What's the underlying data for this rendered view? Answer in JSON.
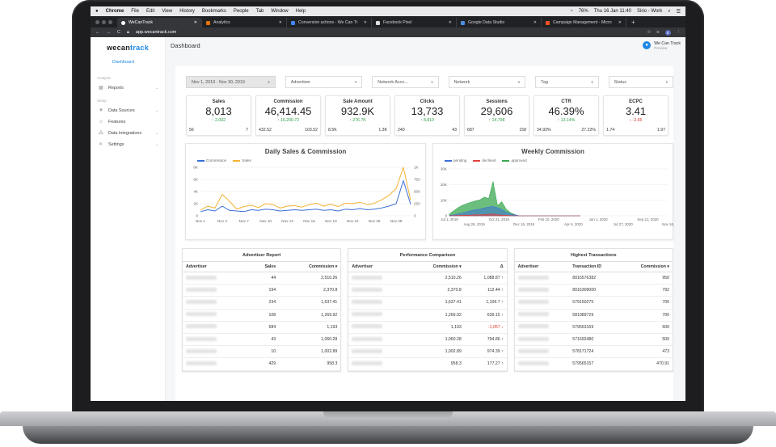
{
  "menubar": {
    "apple": "",
    "items": [
      "Chrome",
      "File",
      "Edit",
      "View",
      "History",
      "Bookmarks",
      "People",
      "Tab",
      "Window",
      "Help"
    ],
    "battery": "76%",
    "clock": "Thu 16 Jan 11:40",
    "user": "Sirio - Work"
  },
  "browser": {
    "tabs": [
      {
        "title": "WeCanTrack",
        "active": true
      },
      {
        "title": "Analytics",
        "active": false
      },
      {
        "title": "Conversion actions - We Can Tr",
        "active": false
      },
      {
        "title": "Facebook Pixel",
        "active": false
      },
      {
        "title": "Google Data Studio",
        "active": false
      },
      {
        "title": "Campaign Management - Micro",
        "active": false
      }
    ],
    "url": "app.wecantrack.com",
    "avatar": "S"
  },
  "sidebar": {
    "logo_a": "wecan",
    "logo_b": "track",
    "dashboard": "Dashboard",
    "section_analysis": "Analysis",
    "section_setup": "Setup",
    "items": [
      {
        "label": "Reports",
        "icon": "chart-icon"
      },
      {
        "label": "Data Sources",
        "icon": "funnel-icon"
      },
      {
        "label": "Features",
        "icon": "people-icon"
      },
      {
        "label": "Data Integrations",
        "icon": "nodes-icon"
      },
      {
        "label": "Settings",
        "icon": "wrench-icon"
      }
    ]
  },
  "header": {
    "title": "Dashboard",
    "user_name": "We Can Track",
    "user_sub": "Preview"
  },
  "filters": {
    "date": "Nov 1, 2019 - Nov 30, 2019",
    "advertiser": "Advertiser",
    "network": "Network Acco...",
    "network2": "Network",
    "tag": "Tag",
    "status": "Status"
  },
  "kpis": [
    {
      "title": "Sales",
      "value": "8,013",
      "delta": "↑ 2,092",
      "dir": "up",
      "left": "56",
      "right": "7"
    },
    {
      "title": "Commission",
      "value": "46,414.45",
      "delta": "↑ 16,200.72",
      "dir": "up",
      "left": "432.52",
      "right": "103.52"
    },
    {
      "title": "Sale Amount",
      "value": "932.9K",
      "delta": "↑ 276.7K",
      "dir": "up",
      "left": "8.5K",
      "right": "1.3K"
    },
    {
      "title": "Clicks",
      "value": "13,733",
      "delta": "↑ 8,810",
      "dir": "up",
      "left": "240",
      "right": "43"
    },
    {
      "title": "Sessions",
      "value": "29,606",
      "delta": "↑ 14,798",
      "dir": "up",
      "left": "687",
      "right": "158"
    },
    {
      "title": "CTR",
      "value": "46.39%",
      "delta": "↑ 13.14%",
      "dir": "up",
      "left": "34.93%",
      "right": "27.22%"
    },
    {
      "title": "ECPC",
      "value": "3.41",
      "delta": "↓ -2.65",
      "dir": "dn",
      "left": "1.74",
      "right": "1.97"
    }
  ],
  "chart_data": [
    {
      "type": "line",
      "title": "Daily Sales & Commission",
      "x": [
        "Nov 1",
        "Nov 4",
        "Nov 7",
        "Nov 10",
        "Nov 13",
        "Nov 16",
        "Nov 19",
        "Nov 22",
        "Nov 25",
        "Nov 28"
      ],
      "yticks_left": [
        "0",
        "2K",
        "4K",
        "6K",
        "8K"
      ],
      "yticks_right": [
        "0",
        "250",
        "500",
        "750",
        "1K"
      ],
      "ylim_left": [
        0,
        8000
      ],
      "ylim_right": [
        0,
        1000
      ],
      "series": [
        {
          "name": "Commission",
          "color": "#3b6fd8",
          "axis": "left",
          "values": [
            700,
            1000,
            800,
            1600,
            900,
            800,
            700,
            1000,
            900,
            1100,
            1000,
            800,
            900,
            1000,
            900,
            1000,
            1100,
            900,
            1000,
            800,
            1100,
            1000,
            1200,
            1000,
            1100,
            1300,
            1600,
            2000,
            5800,
            1900
          ]
        },
        {
          "name": "Sales",
          "color": "#f2b233",
          "axis": "right",
          "values": [
            120,
            200,
            160,
            440,
            300,
            140,
            190,
            220,
            170,
            250,
            230,
            160,
            200,
            210,
            180,
            230,
            260,
            200,
            240,
            190,
            260,
            250,
            280,
            230,
            260,
            330,
            420,
            560,
            1000,
            320
          ]
        }
      ]
    },
    {
      "type": "area",
      "title": "Weekly Commission",
      "x_top": [
        "Jul 1, 2019",
        "Oct 21, 2019",
        "Feb 10, 2020",
        "Jun 1, 2020",
        "Sep 21, 2020"
      ],
      "x_bottom": [
        "Aug 26, 2019",
        "Dec 16, 2019",
        "Apr 6, 2020",
        "Jul 27, 2020",
        "Nov 16, 2020"
      ],
      "yticks": [
        "0",
        "10K",
        "20K",
        "30K"
      ],
      "ylim": [
        0,
        30000
      ],
      "series": [
        {
          "name": "pending",
          "color": "#3b6fd8",
          "values": [
            200,
            600,
            1200,
            1800,
            2600,
            3200,
            4000,
            4200,
            5000,
            5600,
            6000,
            5200,
            4000,
            2400,
            1200,
            600,
            0,
            0,
            0,
            0,
            0,
            0,
            0,
            0,
            0,
            0,
            0,
            0,
            0,
            0,
            0
          ]
        },
        {
          "name": "declined",
          "color": "#e04040",
          "values": [
            0,
            100,
            200,
            300,
            400,
            500,
            800,
            600,
            900,
            1000,
            1200,
            700,
            500,
            300,
            100,
            0,
            0,
            0,
            0,
            0,
            0,
            0,
            0,
            0,
            0,
            0,
            0,
            0,
            0,
            0,
            0
          ]
        },
        {
          "name": "approved",
          "color": "#39a852",
          "values": [
            1200,
            3200,
            5200,
            6800,
            7800,
            8800,
            9500,
            10200,
            12000,
            11000,
            22000,
            6500,
            9000,
            4200,
            2000,
            800,
            0,
            0,
            0,
            0,
            0,
            0,
            0,
            0,
            0,
            0,
            0,
            0,
            0,
            0,
            0
          ]
        }
      ]
    }
  ],
  "tables": {
    "advertiser": {
      "title": "Advertiser Report",
      "cols": [
        "Advertiser",
        "Sales",
        "Commission ▾"
      ],
      "rows": [
        [
          "44",
          "2,510.26"
        ],
        [
          "194",
          "2,370.8"
        ],
        [
          "234",
          "1,637.41"
        ],
        [
          "108",
          "1,269.92"
        ],
        [
          "684",
          "1,193"
        ],
        [
          "43",
          "1,060.28"
        ],
        [
          "10",
          "1,002.89"
        ],
        [
          "429",
          "958.3"
        ]
      ]
    },
    "performance": {
      "title": "Performance Comparison",
      "cols": [
        "Advertiser",
        "Commission ▾",
        "Δ"
      ],
      "rows": [
        [
          "2,510.26",
          "1,088.87 ↑",
          "up"
        ],
        [
          "2,370.8",
          "112.44 ↑",
          "up"
        ],
        [
          "1,637.41",
          "1,109.7 ↑",
          "up"
        ],
        [
          "1,269.92",
          "639.15 ↑",
          "up"
        ],
        [
          "1,193",
          "-1,057 ↓",
          "dn"
        ],
        [
          "1,060.28",
          "794.86 ↑",
          "up"
        ],
        [
          "1,002.89",
          "974.39 ↑",
          "up"
        ],
        [
          "958.3",
          "177.27 ↑",
          "up"
        ]
      ]
    },
    "transactions": {
      "title": "Highest Transactions",
      "cols": [
        "Advertiser",
        "Transaction ID",
        "Commission ▾"
      ],
      "rows": [
        [
          "8016576382",
          "950"
        ],
        [
          "8016309000",
          "792"
        ],
        [
          "579150275",
          "700"
        ],
        [
          "581989729",
          "700"
        ],
        [
          "579563169",
          "600"
        ],
        [
          "571692480",
          "500"
        ],
        [
          "578171724",
          "473"
        ],
        [
          "579565157",
          "470.91"
        ]
      ]
    }
  }
}
